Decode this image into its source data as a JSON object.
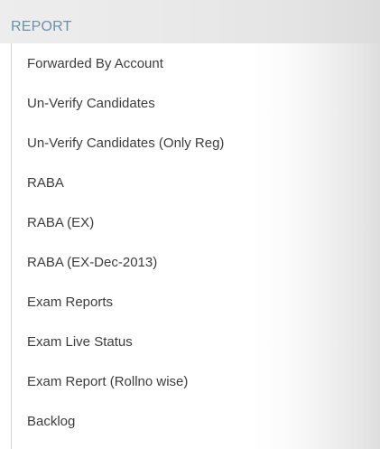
{
  "section": {
    "title": "REPORT"
  },
  "menu": {
    "items": [
      {
        "label": "Forwarded By Account"
      },
      {
        "label": "Un-Verify Candidates"
      },
      {
        "label": "Un-Verify Candidates (Only Reg)"
      },
      {
        "label": "RABA"
      },
      {
        "label": "RABA (EX)"
      },
      {
        "label": "RABA (EX-Dec-2013)"
      },
      {
        "label": "Exam Reports"
      },
      {
        "label": "Exam Live Status"
      },
      {
        "label": "Exam Report (Rollno wise)"
      },
      {
        "label": "Backlog"
      }
    ]
  }
}
